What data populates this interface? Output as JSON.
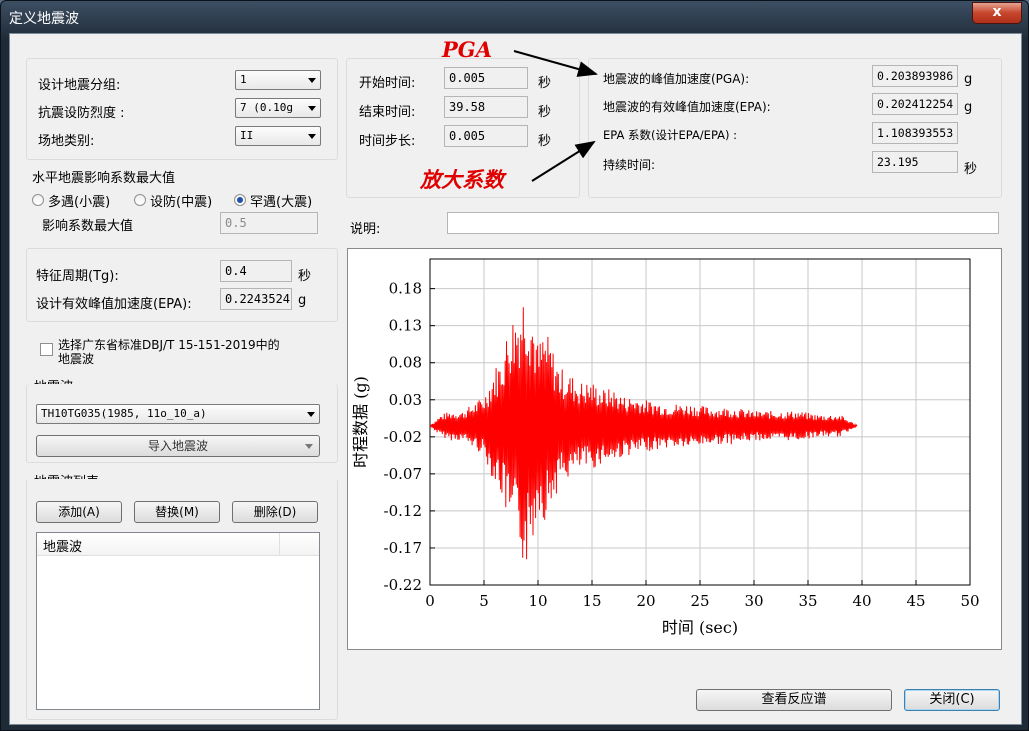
{
  "window": {
    "title": "定义地震波",
    "close_glyph": "x"
  },
  "seismic": {
    "group_label": "设计地震分组:",
    "group_value": "1",
    "intensity_label": "抗震设防烈度 :",
    "intensity_value": "7 (0.10g",
    "site_label": "场地类别:",
    "site_value": "II"
  },
  "horizontal": {
    "title": "水平地震影响系数最大值",
    "options": [
      "多遇(小震)",
      "设防(中震)",
      "罕遇(大震)"
    ],
    "selected_index": 2,
    "max_label": "影响系数最大值",
    "max_value": "0.5"
  },
  "period": {
    "tg_label": "特征周期(Tg):",
    "tg_value": "0.4",
    "tg_unit": "秒",
    "epa_label": "设计有效峰值加速度(EPA):",
    "epa_value": "0.2243524",
    "epa_unit": "g"
  },
  "guangdong": {
    "label_line1": "选择广东省标准DBJ/T 15-151-2019中的",
    "label_line2": "地震波",
    "checked": false
  },
  "wave": {
    "group_title": "地震波",
    "selected": "TH10TG035(1985, 11o_10_a)",
    "import_label": "导入地震波"
  },
  "wavelist": {
    "group_title": "地震波列表",
    "add_label": "添加(A)",
    "replace_label": "替换(M)",
    "delete_label": "删除(D)",
    "column_header": "地震波"
  },
  "time": {
    "start_label": "开始时间:",
    "start_value": "0.005",
    "end_label": "结束时间:",
    "end_value": "39.58",
    "step_label": "时间步长:",
    "step_value": "0.005",
    "unit": "秒"
  },
  "peak": {
    "pga_label": "地震波的峰值加速度(PGA):",
    "pga_value": "0.203893986",
    "pga_unit": "g",
    "epa_label": "地震波的有效峰值加速度(EPA):",
    "epa_value": "0.202412254",
    "epa_unit": "g",
    "ratio_label": "EPA 系数(设计EPA/EPA) :",
    "ratio_value": "1.108393553",
    "duration_label": "持续时间:",
    "duration_value": "23.195",
    "duration_unit": "秒"
  },
  "annotations": {
    "pga": "PGA",
    "factor": "放大系数",
    "color": "#e00000"
  },
  "description": {
    "label": "说明:",
    "value": ""
  },
  "chart_data": {
    "type": "line",
    "xlabel": "时间 (sec)",
    "ylabel": "时程数据 (g)",
    "xlim": [
      0,
      50
    ],
    "ylim": [
      -0.22,
      0.22
    ],
    "xticks": [
      0,
      5,
      10,
      15,
      20,
      25,
      30,
      35,
      40,
      45,
      50
    ],
    "yticks": [
      0.18,
      0.13,
      0.08,
      0.03,
      -0.02,
      -0.07,
      -0.12,
      -0.17,
      -0.22
    ],
    "grid": true,
    "series_color": "#ff0000",
    "x": [
      0,
      1,
      2,
      3,
      4,
      5,
      5.5,
      6,
      6.5,
      7,
      7.5,
      8,
      8.5,
      8.8,
      9,
      9.3,
      9.5,
      10,
      10.5,
      11,
      11.5,
      12,
      13,
      14,
      15,
      16,
      17,
      18,
      19,
      20,
      22,
      24,
      26,
      28,
      30,
      32,
      34,
      36,
      38,
      39.58
    ],
    "y": [
      0.0,
      0.015,
      -0.02,
      0.02,
      -0.03,
      0.04,
      -0.06,
      0.08,
      -0.09,
      0.12,
      -0.15,
      0.16,
      -0.18,
      0.2,
      -0.19,
      0.17,
      -0.16,
      0.11,
      -0.13,
      0.12,
      -0.1,
      0.08,
      -0.07,
      0.06,
      -0.06,
      0.05,
      -0.05,
      0.04,
      -0.04,
      0.035,
      -0.03,
      0.03,
      -0.025,
      0.025,
      -0.02,
      0.02,
      -0.02,
      0.015,
      -0.015,
      0.0
    ]
  },
  "footer": {
    "response_label": "查看反应谱",
    "close_label": "关闭(C)"
  }
}
